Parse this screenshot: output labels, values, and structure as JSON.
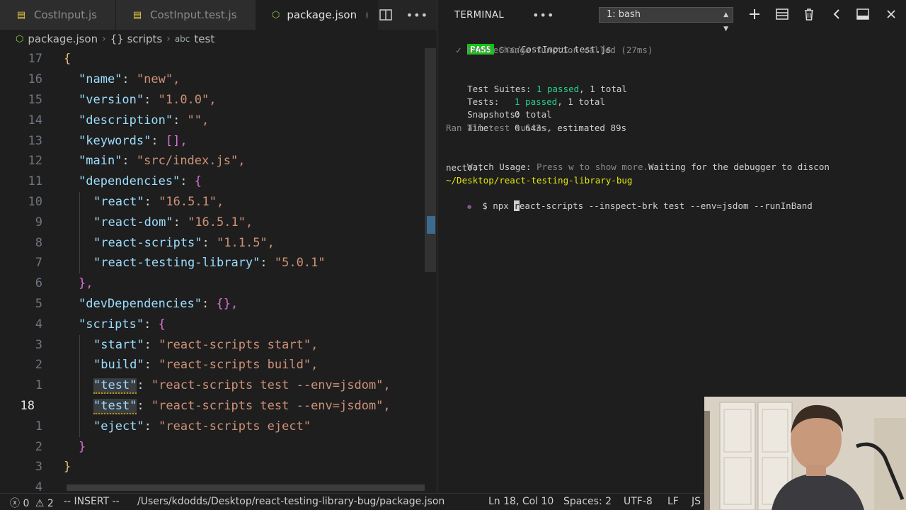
{
  "tabs": [
    {
      "label": "CostInput.js",
      "icon": "js-icon"
    },
    {
      "label": "CostInput.test.js",
      "icon": "js-icon"
    },
    {
      "label": "package.json",
      "icon": "npm-icon",
      "modified": true
    }
  ],
  "breadcrumb": {
    "file": "package.json",
    "section": "{} scripts",
    "key": "test",
    "key_prefix": "abc"
  },
  "editor": {
    "lines": [
      {
        "num": "17",
        "text": "{"
      },
      {
        "num": "16",
        "key": "\"name\"",
        "value": "\"new\","
      },
      {
        "num": "15",
        "key": "\"version\"",
        "value": "\"1.0.0\","
      },
      {
        "num": "14",
        "key": "\"description\"",
        "value": "\"\","
      },
      {
        "num": "13",
        "key": "\"keywords\"",
        "value": "[],"
      },
      {
        "num": "12",
        "key": "\"main\"",
        "value": "\"src/index.js\","
      },
      {
        "num": "11",
        "key": "\"dependencies\"",
        "value": "{"
      },
      {
        "num": "10",
        "key": "\"react\"",
        "value": "\"16.5.1\","
      },
      {
        "num": "9",
        "key": "\"react-dom\"",
        "value": "\"16.5.1\","
      },
      {
        "num": "8",
        "key": "\"react-scripts\"",
        "value": "\"1.1.5\","
      },
      {
        "num": "7",
        "key": "\"react-testing-library\"",
        "value": "\"5.0.1\""
      },
      {
        "num": "6",
        "text": "},"
      },
      {
        "num": "5",
        "key": "\"devDependencies\"",
        "value": "{},"
      },
      {
        "num": "4",
        "key": "\"scripts\"",
        "value": "{"
      },
      {
        "num": "3",
        "key": "\"start\"",
        "value": "\"react-scripts start\","
      },
      {
        "num": "2",
        "key": "\"build\"",
        "value": "\"react-scripts build\","
      },
      {
        "num": "1",
        "key": "\"test\"",
        "value": "\"react-scripts test --env=jsdom\","
      },
      {
        "num": "18",
        "key": "\"test\"",
        "value": "\"react-scripts test --env=jsdom\","
      },
      {
        "num": "1",
        "key": "\"eject\"",
        "value": "\"react-scripts eject\""
      },
      {
        "num": "2",
        "text": "}"
      },
      {
        "num": "3",
        "text": "}"
      },
      {
        "num": "4",
        "text": ""
      }
    ]
  },
  "terminal": {
    "title": "TERMINAL",
    "shell": "1: bash",
    "pass_badge": "PASS",
    "pass_path_dim": "src/",
    "pass_file": "CostInput.test.js",
    "test_line": "✓ handleChange function called (27ms)",
    "suites_label": "Test Suites:",
    "suites_passed": "1 passed",
    "suites_total": ", 1 total",
    "tests_label": "Tests:",
    "tests_passed": "1 passed",
    "tests_total": ", 1 total",
    "snapshots_label": "Snapshots:",
    "snapshots_value": "0 total",
    "time_label": "Time:",
    "time_value": "0.643s, estimated 89s",
    "ran_all": "Ran all test suites.",
    "watch_label": "Watch Usage:",
    "watch_dim": "Press w to show more.",
    "watch_waiting": "Waiting for the debugger to discon",
    "watch_wrap": "nect...",
    "cwd": "~/Desktop/react-testing-library-bug",
    "prompt": "$ npx ",
    "cmd_cursor": "r",
    "cmd_rest": "eact-scripts --inspect-brk test --env=jsdom --runInBand"
  },
  "statusbar": {
    "errors": "0",
    "warnings": "2",
    "mode": "-- INSERT --",
    "path": "/Users/kdodds/Desktop/react-testing-library-bug/package.json",
    "position": "Ln 18, Col 10",
    "spaces": "Spaces: 2",
    "encoding": "UTF-8",
    "eol": "LF",
    "language": "JS"
  },
  "colors": {
    "pass_bg": "#15c213",
    "green": "#23d18b",
    "yellow": "#e5e510",
    "string": "#ce9178",
    "key": "#9cdcfe"
  }
}
